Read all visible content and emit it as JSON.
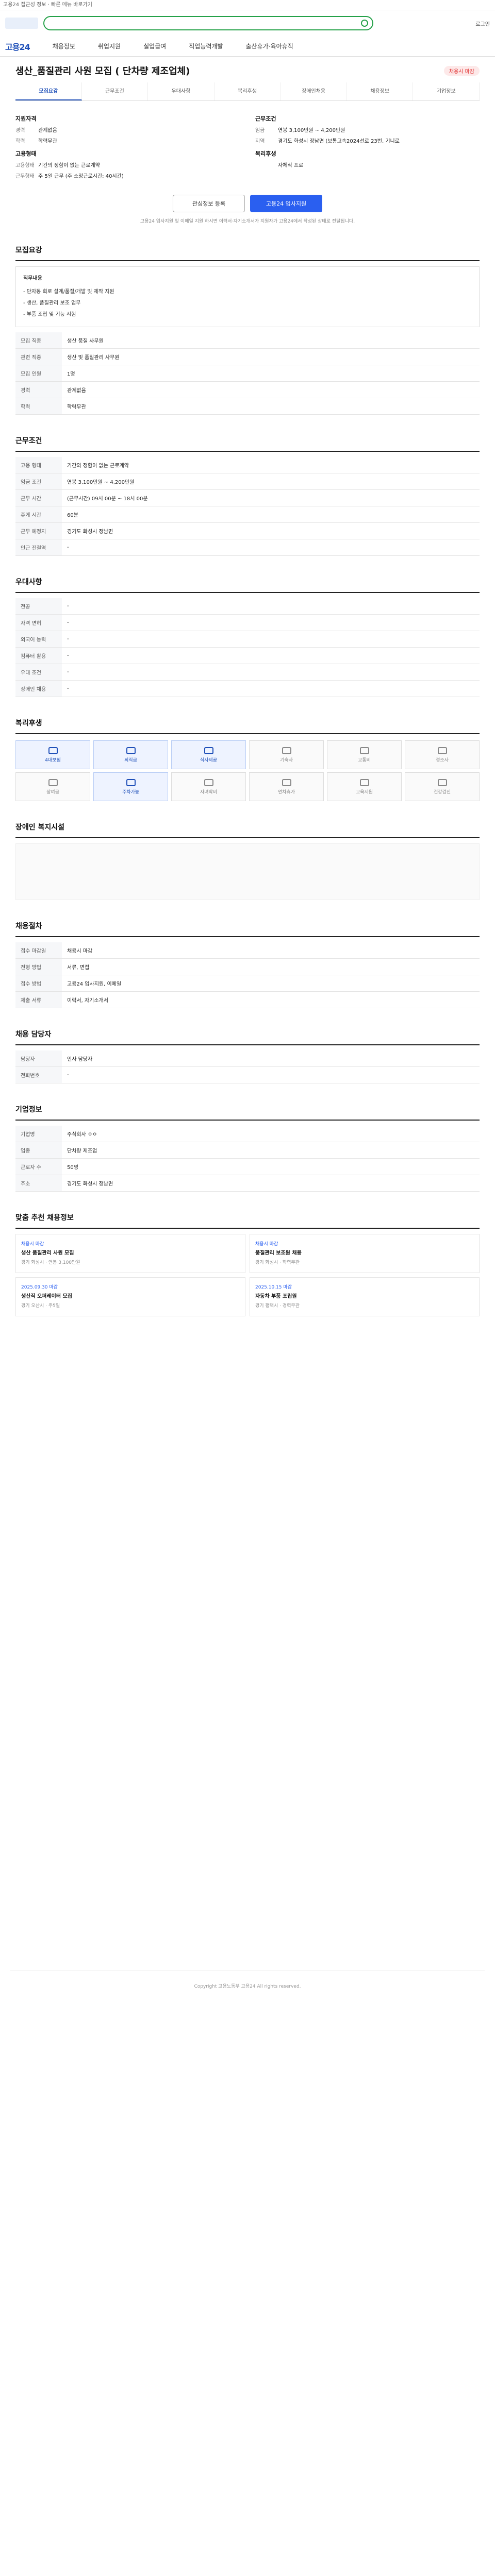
{
  "top": {
    "notice": "고용24 접근성 정보 · 빠른 메뉴 바로가기",
    "login": "로그인"
  },
  "search": {
    "placeholder": ""
  },
  "gnb": {
    "brand": "고용24",
    "items": [
      "채용정보",
      "취업지원",
      "실업급여",
      "직업능력개발",
      "출산휴가·육아휴직"
    ]
  },
  "job": {
    "title": "생산_품질관리 사원 모집 ( 단차량 제조업체)",
    "tag": "채용시 마감",
    "tabs": [
      "모집요강",
      "근무조건",
      "우대사항",
      "복리후생",
      "장애인채용",
      "채용정보",
      "기업정보"
    ],
    "summary": {
      "left_title": "지원자격",
      "left": [
        {
          "k": "경력",
          "v": "관계없음"
        },
        {
          "k": "학력",
          "v": "학력무관"
        }
      ],
      "left_title2": "고용형태",
      "left2": [
        {
          "k": "고용형태",
          "v": "기간의 정함이 없는 근로계약"
        },
        {
          "k": "근무형태",
          "v": "주 5일 근무 (주 소정근로시간: 40시간)"
        }
      ],
      "right_title": "근무조건",
      "right": [
        {
          "k": "임금",
          "v": "연봉 3,100만원 ~ 4,200만원"
        },
        {
          "k": "지역",
          "v": "경기도 화성시 정남면 (보통고속2024선로 23번, 기니로"
        }
      ],
      "right_title2": "복리후생",
      "right2": [
        {
          "k": "",
          "v": "자체식 프로"
        }
      ]
    },
    "buttons": {
      "scrap": "관심정보 등록",
      "apply": "고용24 입사지원"
    },
    "apply_note": "고용24 입사지원 및 이메일 지원 하시면 이력서·자기소개서가 지원자가 고용24에서 작성된 상태로 전달됩니다."
  },
  "sections": {
    "recruit": {
      "title": "모집요강",
      "duty_label": "직무내용",
      "duty": [
        "- 단자동 회로 설계/품질/개발 및 제작 지원",
        "- 생산, 품질관리 보조 업무",
        "- 부품 조립 및 기능 시험"
      ],
      "rows": [
        {
          "k": "모집 직종",
          "v": "생산 품질 사무원"
        },
        {
          "k": "관련 직종",
          "v": "생산 및 품질관리 사무원"
        },
        {
          "k": "모집 인원",
          "v": "1명"
        },
        {
          "k": "경력",
          "v": "관계없음"
        },
        {
          "k": "학력",
          "v": "학력무관"
        }
      ]
    },
    "condition": {
      "title": "근무조건",
      "rows": [
        {
          "k": "고용 형태",
          "v": "기간의 정함이 없는 근로계약"
        },
        {
          "k": "임금 조건",
          "v": "연봉 3,100만원 ~ 4,200만원"
        },
        {
          "k": "근무 시간",
          "v": "(근무시간) 09시 00분 ~ 18시 00분"
        },
        {
          "k": "휴게 시간",
          "v": "60분"
        },
        {
          "k": "근무 예정지",
          "v": "경기도 화성시 정남면"
        },
        {
          "k": "인근 전철역",
          "v": "-"
        }
      ]
    },
    "prefer": {
      "title": "우대사항",
      "rows": [
        {
          "k": "전공",
          "v": "-"
        },
        {
          "k": "자격 면허",
          "v": "-"
        },
        {
          "k": "외국어 능력",
          "v": "-"
        },
        {
          "k": "컴퓨터 활용",
          "v": "-"
        },
        {
          "k": "우대 조건",
          "v": "-"
        },
        {
          "k": "장애인 채용",
          "v": "-"
        }
      ]
    },
    "benefit": {
      "title": "복리후생",
      "items": [
        "4대보험",
        "퇴직금",
        "식사제공",
        "기숙사",
        "교통비",
        "경조사",
        "상여금",
        "주차가능",
        "자녀학비",
        "연차휴가",
        "교육지원",
        "건강검진"
      ]
    },
    "disability": {
      "title": "장애인 복지시설"
    },
    "process": {
      "title": "채용절차",
      "rows": [
        {
          "k": "접수 마감일",
          "v": "채용시 마감"
        },
        {
          "k": "전형 방법",
          "v": "서류, 면접"
        },
        {
          "k": "접수 방법",
          "v": "고용24 입사지원, 이메일"
        },
        {
          "k": "제출 서류",
          "v": "이력서, 자기소개서"
        }
      ]
    },
    "manager": {
      "title": "채용 담당자",
      "rows": [
        {
          "k": "담당자",
          "v": "인사 담당자"
        },
        {
          "k": "전화번호",
          "v": "-"
        }
      ]
    },
    "company": {
      "title": "기업정보",
      "rows": [
        {
          "k": "기업명",
          "v": "주식회사 ㅇㅇ"
        },
        {
          "k": "업종",
          "v": "단차량 제조업"
        },
        {
          "k": "근로자 수",
          "v": "50명"
        },
        {
          "k": "주소",
          "v": "경기도 화성시 정남면"
        }
      ]
    },
    "hot": {
      "title": "맞춤 추천 채용정보",
      "cards": [
        {
          "badge": "채용시 마감",
          "t": "생산 품질관리 사원 모집",
          "d": "경기 화성시 · 연봉 3,100만원"
        },
        {
          "badge": "채용시 마감",
          "t": "품질관리 보조원 채용",
          "d": "경기 화성시 · 학력무관"
        },
        {
          "badge": "2025.09.30 마감",
          "t": "생산직 오퍼레이터 모집",
          "d": "경기 오산시 · 주5일"
        },
        {
          "badge": "2025.10.15 마감",
          "t": "자동차 부품 조립원",
          "d": "경기 평택시 · 경력무관"
        }
      ]
    }
  },
  "footer": "Copyright 고용노동부 고용24 All rights reserved."
}
